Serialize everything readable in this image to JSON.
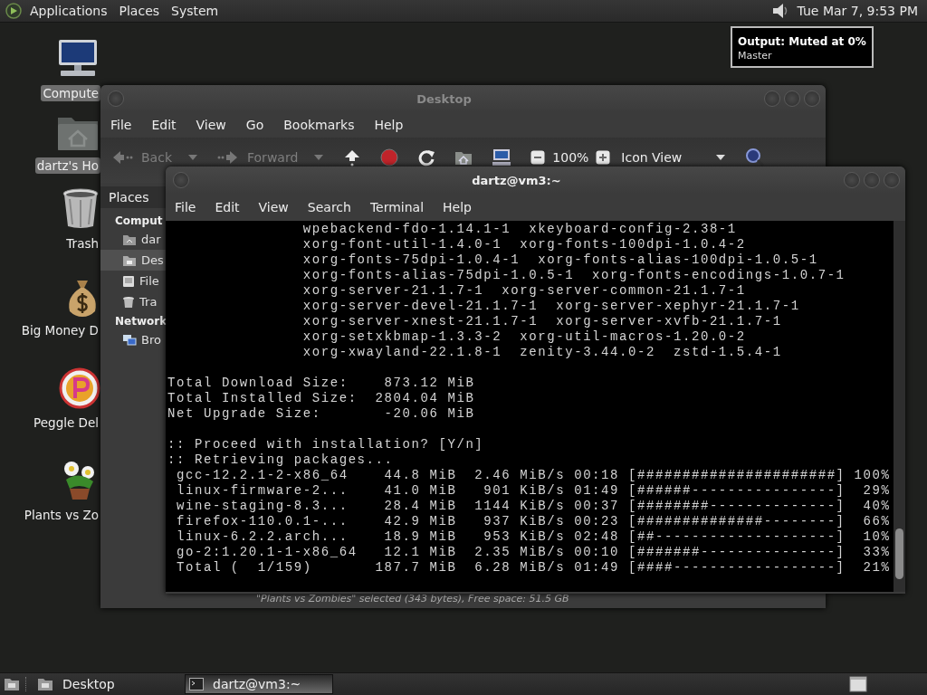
{
  "top_panel": {
    "menus": [
      "Applications",
      "Places",
      "System"
    ],
    "clock": "Tue Mar 7, 9:53 PM"
  },
  "volume_tooltip": {
    "title": "Output: Muted at 0%",
    "subtitle": "Master"
  },
  "desktop_icons": [
    {
      "label": "Compute",
      "kind": "computer",
      "selected": true
    },
    {
      "label": "dartz's Ho",
      "kind": "home",
      "selected": true
    },
    {
      "label": "Trash",
      "kind": "trash",
      "selected": false
    },
    {
      "label": "Big Money D",
      "kind": "money",
      "selected": false
    },
    {
      "label": "Peggle Del",
      "kind": "peggle",
      "selected": false
    },
    {
      "label": "Plants vs Zo",
      "kind": "plant",
      "selected": false
    }
  ],
  "file_manager": {
    "title": "Desktop",
    "active": false,
    "menu": [
      "File",
      "Edit",
      "View",
      "Go",
      "Bookmarks",
      "Help"
    ],
    "toolbar": [
      {
        "kind": "back",
        "label": "Back",
        "disabled": true
      },
      {
        "kind": "forward",
        "label": "Forward",
        "disabled": true
      },
      {
        "kind": "up"
      },
      {
        "kind": "stop"
      },
      {
        "kind": "reload"
      },
      {
        "kind": "home"
      },
      {
        "kind": "computer"
      },
      {
        "kind": "zoom_out"
      },
      {
        "kind": "zoom_level",
        "label": "100%"
      },
      {
        "kind": "zoom_in"
      },
      {
        "kind": "view_select",
        "label": "Icon View"
      },
      {
        "kind": "search"
      }
    ],
    "sidebar": {
      "title": "Places",
      "sections": [
        {
          "label": "Comput",
          "children": [
            {
              "label": "dar",
              "kind": "home",
              "selected": false
            },
            {
              "label": "Des",
              "kind": "desktop",
              "selected": true
            },
            {
              "label": "File",
              "kind": "drive",
              "selected": false
            },
            {
              "label": "Tra",
              "kind": "trash",
              "selected": false
            }
          ]
        },
        {
          "label": "Network",
          "children": [
            {
              "label": "Bro",
              "kind": "network",
              "selected": false
            }
          ]
        }
      ]
    },
    "status_bar": "\"Plants vs Zombies\" selected (343 bytes), Free space: 51.5 GB"
  },
  "terminal": {
    "title": "dartz@vm3:~",
    "active": true,
    "menu": [
      "File",
      "Edit",
      "View",
      "Search",
      "Terminal",
      "Help"
    ],
    "output": [
      {
        "lines": [
          "               wpebackend-fdo-1.14.1-1  xkeyboard-config-2.38-1",
          "               xorg-font-util-1.4.0-1  xorg-fonts-100dpi-1.0.4-2",
          "               xorg-fonts-75dpi-1.0.4-1  xorg-fonts-alias-100dpi-1.0.5-1",
          "               xorg-fonts-alias-75dpi-1.0.5-1  xorg-fonts-encodings-1.0.7-1",
          "               xorg-server-21.1.7-1  xorg-server-common-21.1.7-1",
          "               xorg-server-devel-21.1.7-1  xorg-server-xephyr-21.1.7-1",
          "               xorg-server-xnest-21.1.7-1  xorg-server-xvfb-21.1.7-1",
          "               xorg-setxkbmap-1.3.3-2  xorg-util-macros-1.20.0-2",
          "               xorg-xwayland-22.1.8-1  zenity-3.44.0-2  zstd-1.5.4-1"
        ]
      },
      {
        "lines": [
          "Total Download Size:    873.12 MiB",
          "Total Installed Size:  2804.04 MiB",
          "Net Upgrade Size:       -20.06 MiB"
        ]
      },
      {
        "lines": [
          ":: Proceed with installation? [Y/n]",
          ":: Retrieving packages...",
          " gcc-12.2.1-2-x86_64    44.8 MiB  2.46 MiB/s 00:18 [######################] 100%",
          " linux-firmware-2...    41.0 MiB   901 KiB/s 01:49 [######----------------]  29%",
          " wine-staging-8.3...    28.4 MiB  1144 KiB/s 00:37 [########--------------]  40%",
          " firefox-110.0.1-...    42.9 MiB   937 KiB/s 00:23 [##############--------]  66%",
          " linux-6.2.2.arch...    18.9 MiB   953 KiB/s 02:48 [##--------------------]  10%",
          " go-2:1.20.1-1-x86_64   12.1 MiB  2.35 MiB/s 00:10 [#######---------------]  33%",
          " Total (  1/159)       187.7 MiB  6.28 MiB/s 01:49 [####------------------]  21%"
        ]
      }
    ]
  },
  "taskbar": {
    "tasks": [
      {
        "label": "Desktop",
        "kind": "file_manager",
        "selected": false
      },
      {
        "label": "dartz@vm3:~",
        "kind": "terminal",
        "selected": true
      }
    ]
  }
}
